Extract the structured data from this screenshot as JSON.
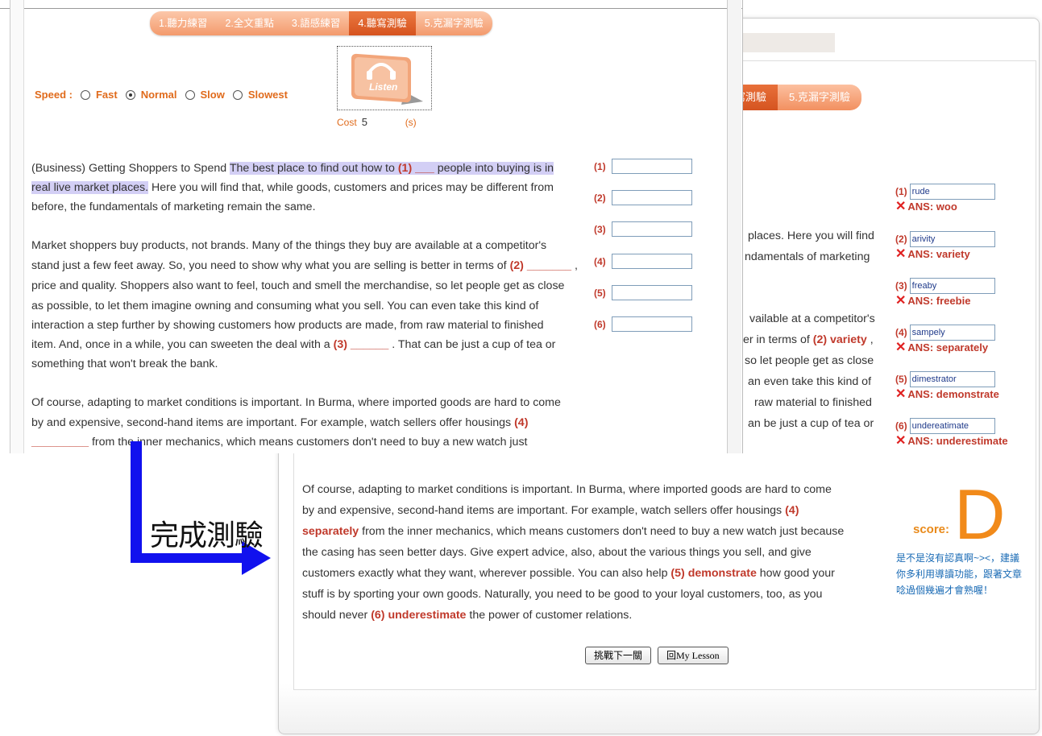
{
  "tabs": [
    "1.聽力練習",
    "2.全文重點",
    "3.語感練習",
    "4.聽寫測驗",
    "5.克漏字測驗"
  ],
  "back_tabs": [
    "寫測驗",
    "5.克漏字測驗"
  ],
  "speed": {
    "label": "Speed :",
    "options": [
      "Fast",
      "Normal",
      "Slow",
      "Slowest"
    ],
    "selected": "Normal"
  },
  "listen_icon": "listen-icon",
  "cost": {
    "label": "Cost",
    "value": "5",
    "unit": "(s)"
  },
  "front_text": {
    "p1_l1_a": "(Business) Getting Shoppers to Spend ",
    "p1_l1_hl": "The best place to find out how to ",
    "p1_l1_blank": "(1) ___",
    "p1_l1_hl2": " people into buying is in",
    "p1_l2_hl": "real live market places.",
    "p1_l2_b": " Here you will find that, while goods, customers and prices may be different from",
    "p1_l3": "before, the fundamentals of marketing remain the same.",
    "p2_l1": "Market shoppers buy products, not brands. Many of the things they buy are available at a competitor's",
    "p2_l2_a": "stand just a few feet away. So, you need to show why what you are selling is better in terms of ",
    "p2_l2_blank": "(2) _______",
    "p2_l2_b": " ,",
    "p2_l3": "price and quality. Shoppers also want to feel, touch and smell the merchandise, so let people get as close",
    "p2_l4": "as possible, to let them imagine owning and consuming what you sell. You can even take this kind of",
    "p2_l5": "interaction a step further by showing customers how products are made, from raw material to finished",
    "p2_l6_a": "item. And, once in a while, you can sweeten the deal with a ",
    "p2_l6_blank": "(3) ______",
    "p2_l6_b": " . That can be just a cup of tea or",
    "p2_l7": "something that won't break the bank.",
    "p3_l1": "Of course, adapting to market conditions is important. In Burma, where imported goods are hard to come",
    "p3_l2_a": "by and expensive, second-hand items are important. For example, watch sellers offer housings ",
    "p3_l2_blank": "(4)",
    "p3_l3_blank": "_________",
    "p3_l3_b": "  from the inner mechanics, which means customers don't need to buy a new watch just"
  },
  "question_numbers": [
    "(1)",
    "(2)",
    "(3)",
    "(4)",
    "(5)",
    "(6)"
  ],
  "back_text": {
    "r1": "places. Here you will find",
    "r2": "ndamentals of marketing",
    "r3": "vailable at a competitor's",
    "r4_a": "er in terms of ",
    "r4_blank": "(2) variety",
    "r4_b": " ,",
    "r5": "so let people get as close",
    "r6": "an even take this kind of",
    "r7": "raw material to finished",
    "r8": "an be just a cup of tea or",
    "p3_l1": "Of course, adapting to market conditions is important. In Burma, where imported goods are hard to come",
    "p3_l2_a": "by and expensive, second-hand items are important. For example, watch sellers offer housings ",
    "p3_l2_blank": "(4)",
    "p3_l3_blank": "separately",
    "p3_l3_b": " from the inner mechanics, which means customers don't need to buy a new watch just because",
    "p3_l4": "the casing has seen better days. Give expert advice, also, about the various things you sell, and give",
    "p3_l5_a": "customers exactly what they want, wherever possible. You can also help ",
    "p3_l5_blank": "(5) demonstrate",
    "p3_l5_b": " how good your",
    "p3_l6": "stuff is by sporting your own goods. Naturally, you need to be good to your loyal customers, too, as you",
    "p3_l7_a": "should never ",
    "p3_l7_blank": "(6) underestimate",
    "p3_l7_b": " the power of customer relations."
  },
  "answers": [
    {
      "num": "(1)",
      "given": "rude",
      "ans": "ANS: woo"
    },
    {
      "num": "(2)",
      "given": "arivity",
      "ans": "ANS: variety"
    },
    {
      "num": "(3)",
      "given": "freaby",
      "ans": "ANS: freebie"
    },
    {
      "num": "(4)",
      "given": "sampely",
      "ans": "ANS: separately"
    },
    {
      "num": "(5)",
      "given": "dimestrator",
      "ans": "ANS: demonstrate"
    },
    {
      "num": "(6)",
      "given": "undereatimate",
      "ans": "ANS: underestimate"
    }
  ],
  "score": {
    "label": "score:",
    "grade": "D",
    "comment": "是不是沒有認真啊~><，建議你多利用導讀功能，跟著文章唸過個幾遍才會熟喔！"
  },
  "buttons": {
    "next": "挑戰下一關",
    "back": "回My Lesson"
  },
  "arrow_label": "完成測驗",
  "colors": {
    "accent": "#e06b1c",
    "tab_active": "#d6531e",
    "error": "#e02020",
    "arrow": "#1111ee",
    "highlight": "#d3cff5"
  }
}
